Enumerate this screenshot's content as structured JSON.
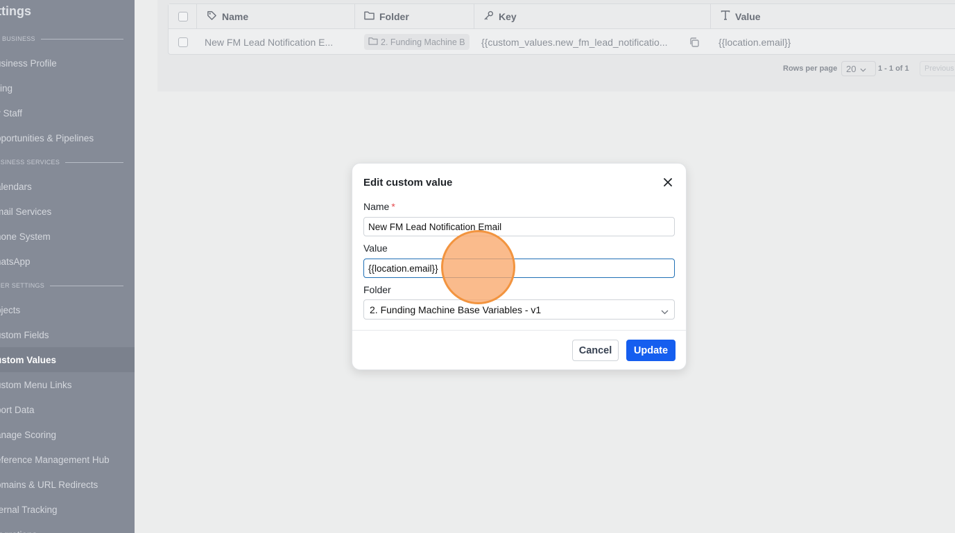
{
  "sidebar": {
    "title": "ttings",
    "sections": [
      {
        "label": "Y BUSINESS"
      },
      {
        "label": "USINESS SERVICES"
      },
      {
        "label": "HER SETTINGS"
      }
    ],
    "items": [
      {
        "label": "usiness Profile"
      },
      {
        "label": "lling"
      },
      {
        "label": "y Staff"
      },
      {
        "label": "pportunities & Pipelines"
      },
      {
        "label": "alendars"
      },
      {
        "label": "mail Services"
      },
      {
        "label": "hone System"
      },
      {
        "label": "hatsApp"
      },
      {
        "label": "bjects"
      },
      {
        "label": "ustom Fields"
      },
      {
        "label": "ustom Values"
      },
      {
        "label": "ustom Menu Links"
      },
      {
        "label": "port Data"
      },
      {
        "label": "anage Scoring"
      },
      {
        "label": "eference Management Hub"
      },
      {
        "label": "omains & URL Redirects"
      },
      {
        "label": "ternal Tracking"
      },
      {
        "label": "tegrations"
      }
    ]
  },
  "table": {
    "headers": {
      "name": "Name",
      "folder": "Folder",
      "key": "Key",
      "value": "Value"
    },
    "rows": [
      {
        "name": "New FM Lead Notification E...",
        "folder": "2. Funding Machine B",
        "key": "{{custom_values.new_fm_lead_notificatio...",
        "value": "{{location.email}}"
      }
    ],
    "pagination": {
      "rows_per_page_label": "Rows per page",
      "rows_per_page_value": "20",
      "range": "1 - 1 of 1",
      "previous_label": "Previous"
    }
  },
  "modal": {
    "title": "Edit custom value",
    "name_label": "Name",
    "required_mark": "*",
    "name_value": "New FM Lead Notification Email",
    "value_label": "Value",
    "value_value": "{{location.email}}",
    "folder_label": "Folder",
    "folder_value": "2. Funding Machine Base Variables - v1",
    "cancel_label": "Cancel",
    "update_label": "Update"
  },
  "colors": {
    "primary": "#155eef",
    "click_indicator": "#f2943f",
    "required": "#e5484d"
  }
}
